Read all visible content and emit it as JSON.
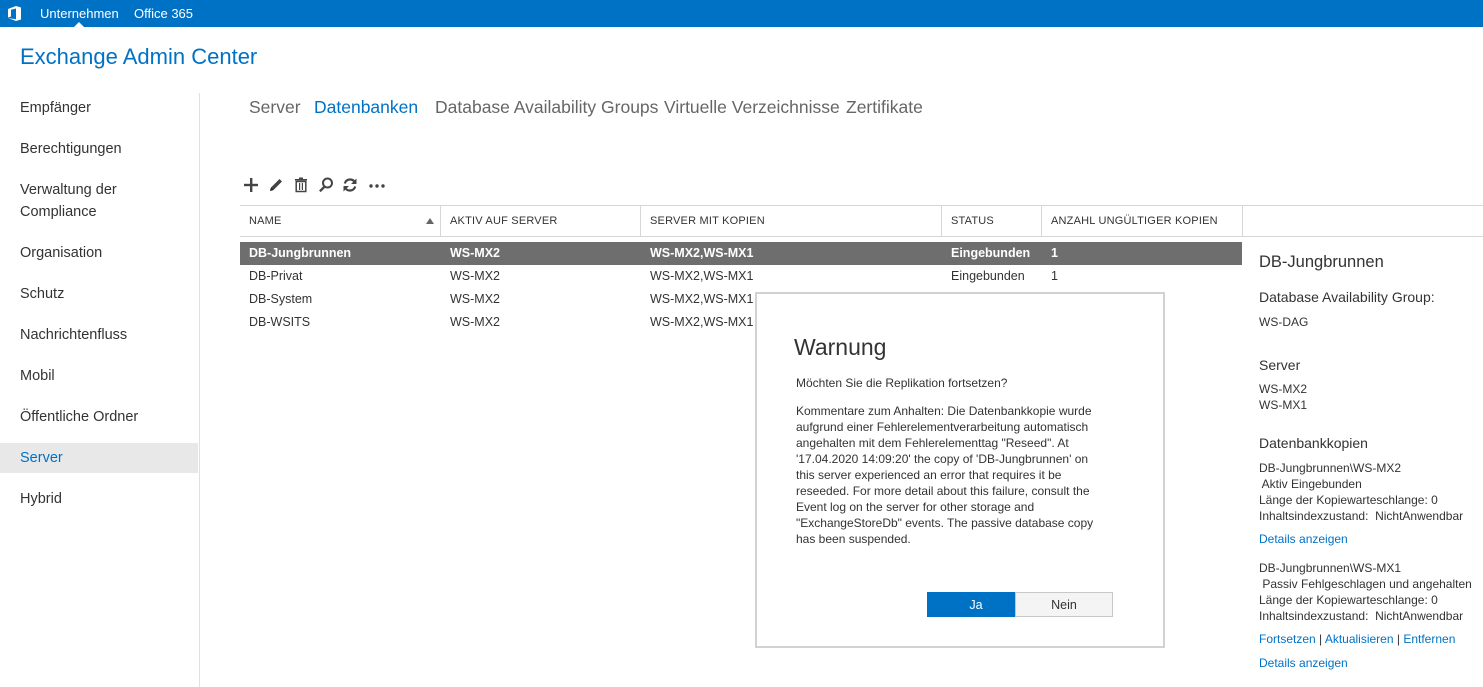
{
  "topbar": {
    "nav": [
      "Unternehmen",
      "Office 365"
    ],
    "colors": {
      "bar": "#0072c6",
      "text": "#ffffff"
    }
  },
  "app_title": "Exchange Admin Center",
  "sidebar": {
    "items": [
      {
        "label": "Empfänger"
      },
      {
        "label": "Berechtigungen"
      },
      {
        "label": "Verwaltung der Compliance"
      },
      {
        "label": "Organisation"
      },
      {
        "label": "Schutz"
      },
      {
        "label": "Nachrichtenfluss"
      },
      {
        "label": "Mobil"
      },
      {
        "label": "Öffentliche Ordner"
      },
      {
        "label": "Server",
        "selected": true
      },
      {
        "label": "Hybrid"
      }
    ]
  },
  "tabs": [
    {
      "label": "Server"
    },
    {
      "label": "Datenbanken",
      "active": true
    },
    {
      "label": "Database Availability Groups"
    },
    {
      "label": "Virtuelle Verzeichnisse"
    },
    {
      "label": "Zertifikate"
    }
  ],
  "toolbar": {
    "icons": [
      "add-icon",
      "edit-icon",
      "delete-icon",
      "search-icon",
      "refresh-icon",
      "more-icon"
    ]
  },
  "table": {
    "columns": [
      "NAME",
      "AKTIV AUF SERVER",
      "SERVER MIT KOPIEN",
      "STATUS",
      "ANZAHL UNGÜLTIGER KOPIEN"
    ],
    "rows": [
      {
        "name": "DB-Jungbrunnen",
        "active": "WS-MX2",
        "copies": "WS-MX2,WS-MX1",
        "status": "Eingebunden",
        "bad": "1",
        "selected": true
      },
      {
        "name": "DB-Privat",
        "active": "WS-MX2",
        "copies": "WS-MX2,WS-MX1",
        "status": "Eingebunden",
        "bad": "1"
      },
      {
        "name": "DB-System",
        "active": "WS-MX2",
        "copies": "WS-MX2,WS-MX1",
        "status": "",
        "bad": ""
      },
      {
        "name": "DB-WSITS",
        "active": "WS-MX2",
        "copies": "WS-MX2,WS-MX1",
        "status": "",
        "bad": ""
      }
    ]
  },
  "detail": {
    "title": "DB-Jungbrunnen",
    "dag_label": "Database Availability Group:",
    "dag_value": "WS-DAG",
    "server_label": "Server",
    "servers": [
      "WS-MX2",
      "WS-MX1"
    ],
    "copies_label": "Datenbankkopien",
    "copy1": {
      "name": "DB-Jungbrunnen\\WS-MX2",
      "state": " Aktiv Eingebunden",
      "queue": "Länge der Kopiewarteschlange: 0",
      "index": "Inhaltsindexzustand:  NichtAnwendbar",
      "details": "Details anzeigen"
    },
    "copy2": {
      "name": "DB-Jungbrunnen\\WS-MX1",
      "state": " Passiv Fehlgeschlagen und angehalten",
      "queue": "Länge der Kopiewarteschlange: 0",
      "index": "Inhaltsindexzustand:  NichtAnwendbar",
      "actions": [
        "Fortsetzen",
        "Aktualisieren",
        "Entfernen"
      ],
      "separator": " | ",
      "details": "Details anzeigen"
    }
  },
  "dialog": {
    "title": "Warnung",
    "question": "Möchten Sie die Replikation fortsetzen?",
    "body": "Kommentare zum Anhalten: Die Datenbankkopie wurde aufgrund einer Fehlerelementverarbeitung automatisch angehalten mit dem Fehlerelementtag \"Reseed\". At '17.04.2020 14:09:20' the copy of 'DB-Jungbrunnen' on this server experienced an error that requires it be reseeded. For more detail about this failure, consult the Event log on the server for other storage and \"ExchangeStoreDb\" events. The passive database copy has been suspended.",
    "yes_label": "Ja",
    "no_label": "Nein"
  },
  "colors": {
    "accent": "#0072c6",
    "selected_row": "#6e6e6e",
    "selected_nav": "#e8e8e8"
  }
}
